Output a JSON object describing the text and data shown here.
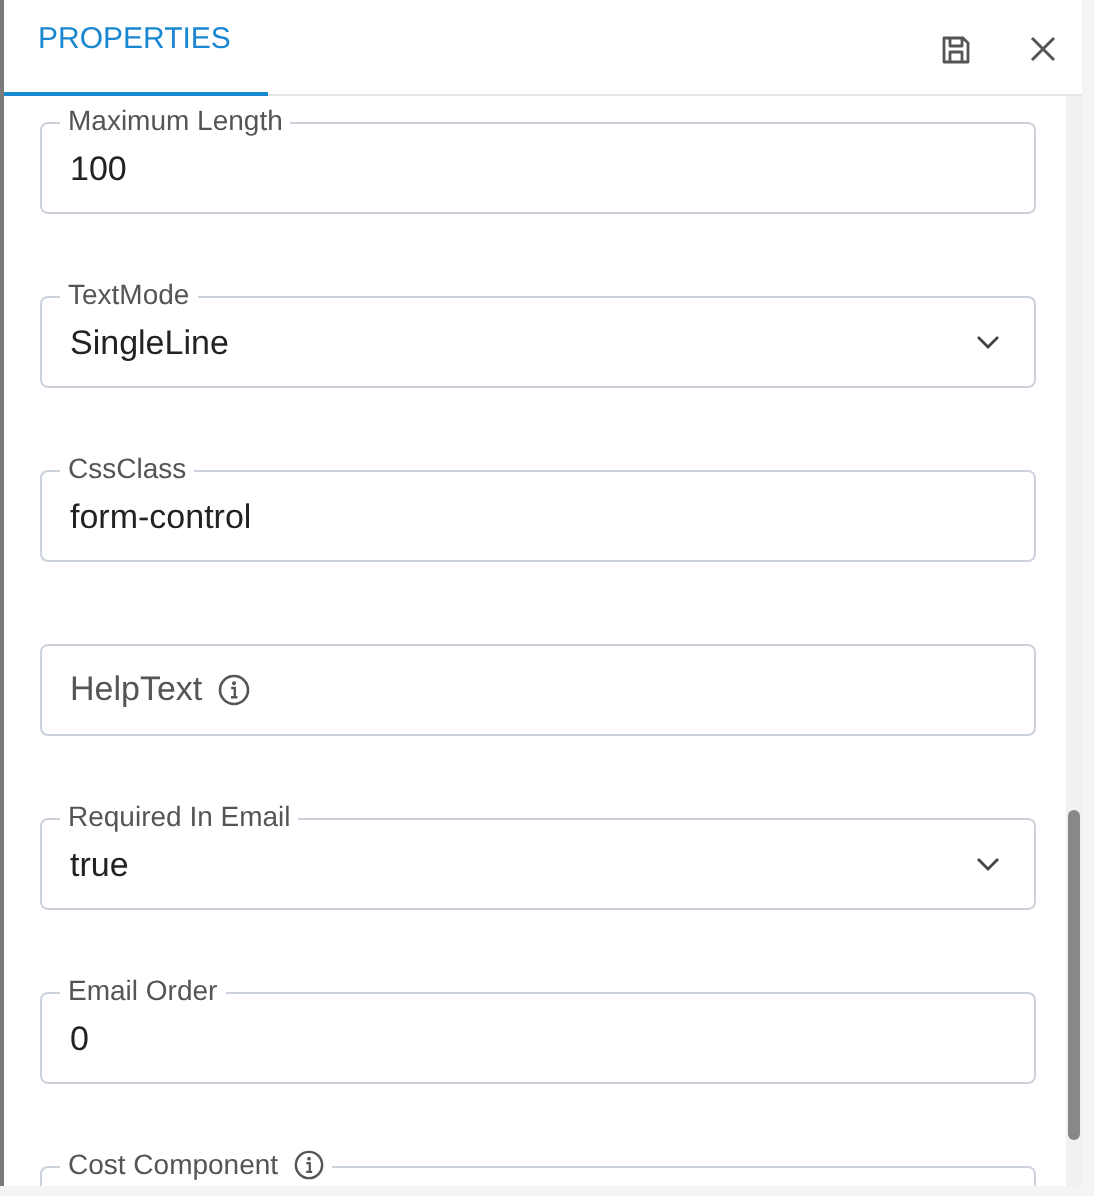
{
  "tabs": [
    {
      "label": "PROPERTIES",
      "selected": true
    }
  ],
  "fields": [
    {
      "kind": "text",
      "label": "Maximum Length",
      "value": "100",
      "info_icon": false
    },
    {
      "kind": "select",
      "label": "TextMode",
      "value": "SingleLine",
      "info_icon": false
    },
    {
      "kind": "text",
      "label": "CssClass",
      "value": "form-control",
      "info_icon": false
    },
    {
      "kind": "text",
      "label": "HelpText",
      "info_icon": true
    },
    {
      "kind": "select",
      "label": "Required In Email",
      "value": "true",
      "info_icon": false
    },
    {
      "kind": "text",
      "label": "Email Order",
      "value": "0",
      "info_icon": false
    },
    {
      "kind": "text",
      "label": "Cost Component",
      "info_icon": true,
      "floated": true
    }
  ]
}
